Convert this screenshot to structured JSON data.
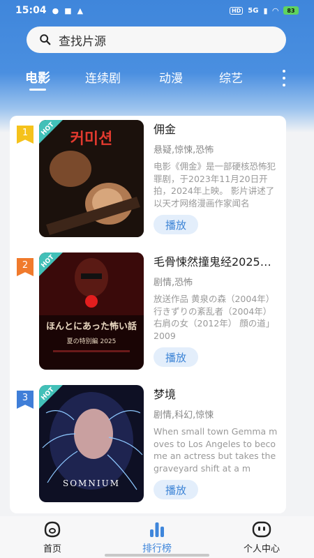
{
  "status_bar": {
    "time": "15:04",
    "network": "5G",
    "battery": "83"
  },
  "search": {
    "placeholder": "查找片源"
  },
  "tabs": [
    {
      "label": "电影",
      "active": true
    },
    {
      "label": "连续剧",
      "active": false
    },
    {
      "label": "动漫",
      "active": false
    },
    {
      "label": "综艺",
      "active": false
    }
  ],
  "items": [
    {
      "rank": "1",
      "rank_color": "#f5c21b",
      "hot": "HOT",
      "title": "佣金",
      "tags": "悬疑,惊悚,恐怖",
      "description": "电影《佣金》是一部硬核恐怖犯罪剧，于2023年11月20日开拍，2024年上映。 影片讲述了以天才网络漫画作家闻名",
      "play": "播放",
      "poster_text": "커미션"
    },
    {
      "rank": "2",
      "rank_color": "#f07a2c",
      "hot": "HOT",
      "title": "毛骨悚然撞鬼经2025夏…",
      "tags": "剧情,恐怖",
      "description": "放送作品 黄泉の森（2004年） 行きずりの紊乱者（2004年） 右肩の女（2012年） 顔の道」2009",
      "play": "播放",
      "poster_text": "ほんとにあった怖い話",
      "poster_subtext": "夏の特別編 2025"
    },
    {
      "rank": "3",
      "rank_color": "#3f7ed8",
      "hot": "HOT",
      "title": "梦境",
      "tags": "剧情,科幻,惊悚",
      "description": "When small town Gemma moves to Los Angeles to become an actress but takes the graveyard shift at a m",
      "play": "播放",
      "poster_text": "SOMNIUM"
    }
  ],
  "bottom_nav": [
    {
      "label": "首页",
      "active": false
    },
    {
      "label": "排行榜",
      "active": true
    },
    {
      "label": "个人中心",
      "active": false
    }
  ],
  "colors": {
    "accent": "#3f86db",
    "hot": "#42c0b8"
  }
}
